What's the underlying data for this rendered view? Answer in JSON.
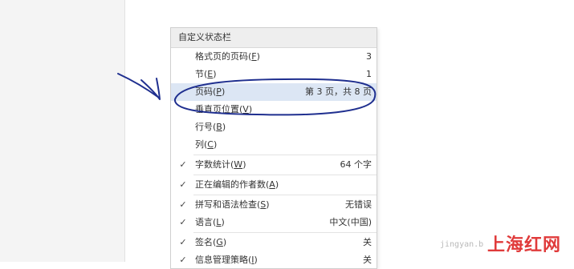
{
  "menu": {
    "title": "自定义状态栏",
    "items": [
      {
        "label": "格式页的页码(",
        "key": "F",
        "value": "3",
        "checked": false
      },
      {
        "label": "节(",
        "key": "E",
        "value": "1",
        "checked": false
      },
      {
        "label": "页码(",
        "key": "P",
        "value": "第 3 页，共 8 页",
        "checked": false
      },
      {
        "label": "垂直页位置(",
        "key": "V",
        "value": "",
        "checked": false
      },
      {
        "label": "行号(",
        "key": "B",
        "value": "",
        "checked": false
      },
      {
        "label": "列(",
        "key": "C",
        "value": "",
        "checked": false
      },
      {
        "label": "字数统计(",
        "key": "W",
        "value": "64 个字",
        "checked": true
      },
      {
        "label": "正在编辑的作者数(",
        "key": "A",
        "value": "",
        "checked": true
      },
      {
        "label": "拼写和语法检查(",
        "key": "S",
        "value": "无错误",
        "checked": true
      },
      {
        "label": "语言(",
        "key": "L",
        "value": "中文(中国)",
        "checked": true
      },
      {
        "label": "签名(",
        "key": "G",
        "value": "关",
        "checked": true
      },
      {
        "label": "信息管理策略(",
        "key": "I",
        "value": "关",
        "checked": true
      }
    ],
    "checkmark": "✓"
  },
  "watermark": "jingyan.b",
  "logo": "上海红网",
  "colors": {
    "highlight": "#dce6f4",
    "annotation": "#1f2f8f",
    "logo": "#e03b3b"
  }
}
